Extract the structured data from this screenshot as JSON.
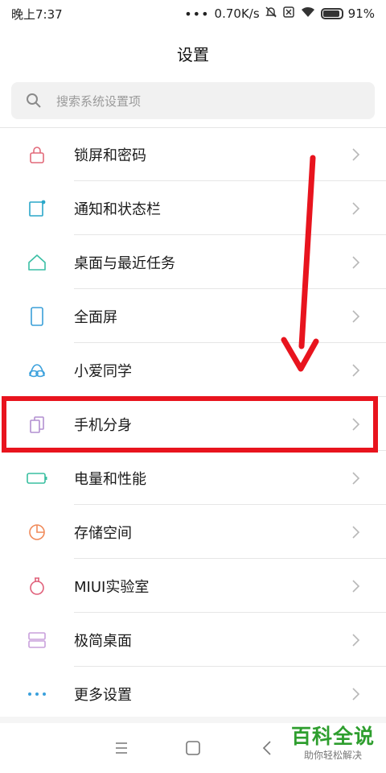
{
  "status_bar": {
    "time": "晚上7:37",
    "dots": "•••",
    "network_speed": "0.70K/s",
    "battery_percent": "91%",
    "battery_level": 0.91
  },
  "header": {
    "title": "设置"
  },
  "search": {
    "placeholder": "搜索系统设置项"
  },
  "settings": {
    "items": [
      {
        "label": "锁屏和密码",
        "icon": "lock-icon",
        "color": "#e26a7a"
      },
      {
        "label": "通知和状态栏",
        "icon": "notification-icon",
        "color": "#2aa7c9"
      },
      {
        "label": "桌面与最近任务",
        "icon": "home-icon",
        "color": "#3bbfa5"
      },
      {
        "label": "全面屏",
        "icon": "phone-icon",
        "color": "#3a9fd8"
      },
      {
        "label": "小爱同学",
        "icon": "xiaoai-icon",
        "color": "#3aa0dc"
      },
      {
        "label": "手机分身",
        "icon": "second-space-icon",
        "color": "#b28fd0"
      },
      {
        "label": "电量和性能",
        "icon": "battery-icon",
        "color": "#39bfa0"
      },
      {
        "label": "存储空间",
        "icon": "storage-icon",
        "color": "#f08a5a"
      },
      {
        "label": "MIUI实验室",
        "icon": "lab-flask-icon",
        "color": "#e0607a"
      },
      {
        "label": "极简桌面",
        "icon": "simple-desktop-icon",
        "color": "#c9a0dc"
      },
      {
        "label": "更多设置",
        "icon": "more-icon",
        "color": "#3aa0dc"
      }
    ]
  },
  "annotation": {
    "highlight_color": "#e8141e"
  },
  "watermark": {
    "main": "百科全说",
    "sub": "助你轻松解决",
    "color": "#2e9e2e"
  }
}
